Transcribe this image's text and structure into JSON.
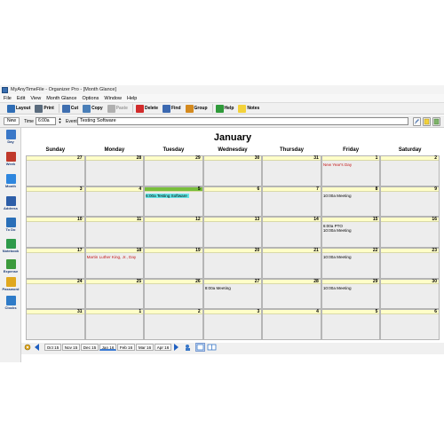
{
  "window": {
    "title": "MyAnyTimeFile - Organizer Pro - [Month Glance]"
  },
  "menu": [
    "File",
    "Edit",
    "View",
    "Month Glance",
    "Options",
    "Window",
    "Help"
  ],
  "toolbar": {
    "buttons": [
      {
        "label": "Layout",
        "icon": "layout-icon",
        "color": "#2f6db5",
        "disabled": false
      },
      {
        "label": "Print",
        "icon": "print-icon",
        "color": "#5a6b7d",
        "disabled": false
      },
      {
        "label": "Cut",
        "icon": "scissors-icon",
        "color": "#3f6fb0",
        "disabled": false
      },
      {
        "label": "Copy",
        "icon": "copy-icon",
        "color": "#4a7fb8",
        "disabled": false
      },
      {
        "label": "Paste",
        "icon": "paste-icon",
        "color": "#b0b0b0",
        "disabled": true
      },
      {
        "label": "Delete",
        "icon": "delete-icon",
        "color": "#d12b2b",
        "disabled": false
      },
      {
        "label": "Find",
        "icon": "find-icon",
        "color": "#3b68b0",
        "disabled": false
      },
      {
        "label": "Group",
        "icon": "group-icon",
        "color": "#d48a1e",
        "disabled": false
      },
      {
        "label": "Help",
        "icon": "help-icon",
        "color": "#2f9a3a",
        "disabled": false
      },
      {
        "label": "Notes",
        "icon": "notes-icon",
        "color": "#f3d23a",
        "disabled": false
      }
    ]
  },
  "entry": {
    "new_label": "New",
    "time_label": "Time",
    "time_value": "6:00a",
    "event_label": "Event",
    "event_value": "Testing Software"
  },
  "sidebar": {
    "items": [
      {
        "label": "Day",
        "icon": "day-icon",
        "color": "#3a78c8"
      },
      {
        "label": "Week",
        "icon": "week-icon",
        "color": "#c0392b"
      },
      {
        "label": "Month",
        "icon": "month-icon",
        "color": "#2e86de"
      },
      {
        "label": "Address",
        "icon": "address-icon",
        "color": "#2d5ea8"
      },
      {
        "label": "To Do",
        "icon": "todo-icon",
        "color": "#2a6fb8"
      },
      {
        "label": "Notebook",
        "icon": "notebook-icon",
        "color": "#2e9a4a"
      },
      {
        "label": "Expense",
        "icon": "expense-icon",
        "color": "#3c9a3c"
      },
      {
        "label": "Password",
        "icon": "key-icon",
        "color": "#e0a820"
      },
      {
        "label": "Clocks",
        "icon": "clock-icon",
        "color": "#2e7bc8"
      }
    ]
  },
  "calendar": {
    "month": "January",
    "weekdays": [
      "Sunday",
      "Monday",
      "Tuesday",
      "Wednesday",
      "Thursday",
      "Friday",
      "Saturday"
    ],
    "weeks": [
      [
        {
          "d": "27"
        },
        {
          "d": "28"
        },
        {
          "d": "29"
        },
        {
          "d": "30"
        },
        {
          "d": "31"
        },
        {
          "d": "1",
          "events": [
            {
              "text": "New Year's Day",
              "type": "holiday"
            }
          ]
        },
        {
          "d": "2"
        }
      ],
      [
        {
          "d": "3"
        },
        {
          "d": "4"
        },
        {
          "d": "5",
          "today": true,
          "events": [
            {
              "text": "6:00a Testing Software",
              "type": "selected"
            }
          ]
        },
        {
          "d": "6"
        },
        {
          "d": "7"
        },
        {
          "d": "8",
          "events": [
            {
              "text": "10:00a Meeting",
              "type": "normal"
            }
          ]
        },
        {
          "d": "9"
        }
      ],
      [
        {
          "d": "10"
        },
        {
          "d": "11"
        },
        {
          "d": "12"
        },
        {
          "d": "13"
        },
        {
          "d": "14"
        },
        {
          "d": "15",
          "events": [
            {
              "text": "6:00a PTO",
              "type": "normal"
            },
            {
              "text": "10:00a Meeting",
              "type": "normal"
            }
          ]
        },
        {
          "d": "16"
        }
      ],
      [
        {
          "d": "17"
        },
        {
          "d": "18",
          "events": [
            {
              "text": "Martin Luther King, Jr., Day",
              "type": "holiday"
            }
          ]
        },
        {
          "d": "19"
        },
        {
          "d": "20"
        },
        {
          "d": "21"
        },
        {
          "d": "22",
          "events": [
            {
              "text": "10:00a Meeting",
              "type": "normal"
            }
          ]
        },
        {
          "d": "23"
        }
      ],
      [
        {
          "d": "24"
        },
        {
          "d": "25"
        },
        {
          "d": "26"
        },
        {
          "d": "27",
          "events": [
            {
              "text": "8:00a Meeting",
              "type": "normal"
            }
          ]
        },
        {
          "d": "28"
        },
        {
          "d": "29",
          "events": [
            {
              "text": "10:00a Meeting",
              "type": "normal"
            }
          ]
        },
        {
          "d": "30"
        }
      ],
      [
        {
          "d": "31"
        },
        {
          "d": "1"
        },
        {
          "d": "2"
        },
        {
          "d": "3"
        },
        {
          "d": "4"
        },
        {
          "d": "5"
        },
        {
          "d": "6"
        }
      ]
    ]
  },
  "month_tabs": [
    "Oct 15",
    "Nov 15",
    "Dec 15",
    "Jan 16",
    "Feb 16",
    "Mar 16",
    "Apr 16"
  ],
  "current_tab": "Jan 16",
  "colors": {
    "today_header": "#79bf3b",
    "selected_event": "#64e6e6",
    "holiday": "#c41a1a",
    "date_header": "#fffec8"
  }
}
